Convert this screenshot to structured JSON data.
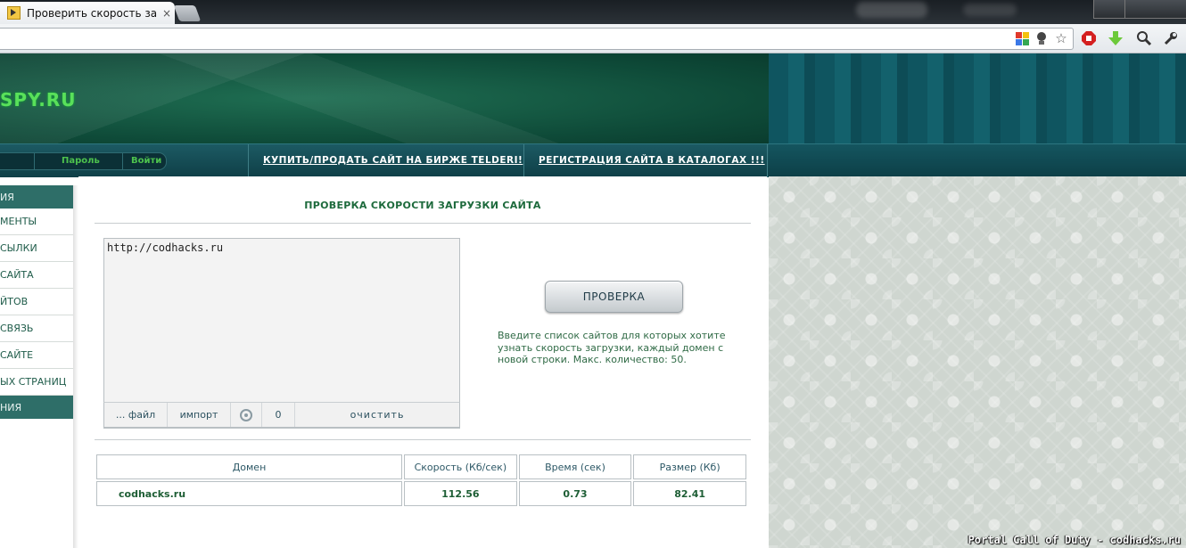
{
  "browser": {
    "tab_title": "Проверить скорость загру",
    "tab_close": "×"
  },
  "site": {
    "logo": "SPY.RU",
    "login": {
      "password_label": "Пароль",
      "login_button": "Войти"
    },
    "nav": [
      "КУПИТЬ/ПРОДАТЬ САЙТ НА БИРЖЕ TELDERI!",
      "РЕГИСТРАЦИЯ САЙТА В КАТАЛОГАХ !!!"
    ],
    "sidebar": {
      "head_top": "ИЯ",
      "items": [
        "МЕНТЫ",
        "СЫЛКИ",
        "САЙТА",
        "ЙТОВ",
        "СВЯЗЬ",
        "САЙТЕ",
        "ЫХ СТРАНИЦ"
      ],
      "head_bottom": "НИЯ"
    }
  },
  "main": {
    "title": "ПРОВЕРКА СКОРОСТИ ЗАГРУЗКИ САЙТА",
    "textarea_value": "http://codhacks.ru",
    "toolbar": {
      "file": "... файл",
      "import": "импорт",
      "count": "0",
      "clear": "очистить"
    },
    "check_button": "ПРОВЕРКА",
    "hint": "Введите список сайтов для которых хотите узнать скорость загрузки, каждый домен с новой строки. Макс. количество: 50."
  },
  "results": {
    "headers": [
      "Домен",
      "Скорость (Кб/сек)",
      "Время (сек)",
      "Размер (Кб)"
    ],
    "rows": [
      {
        "domain": "codhacks.ru",
        "speed": "112.56",
        "time": "0.73",
        "size": "82.41"
      }
    ]
  },
  "watermark": "Portal Call of Duty - codhacks.ru"
}
